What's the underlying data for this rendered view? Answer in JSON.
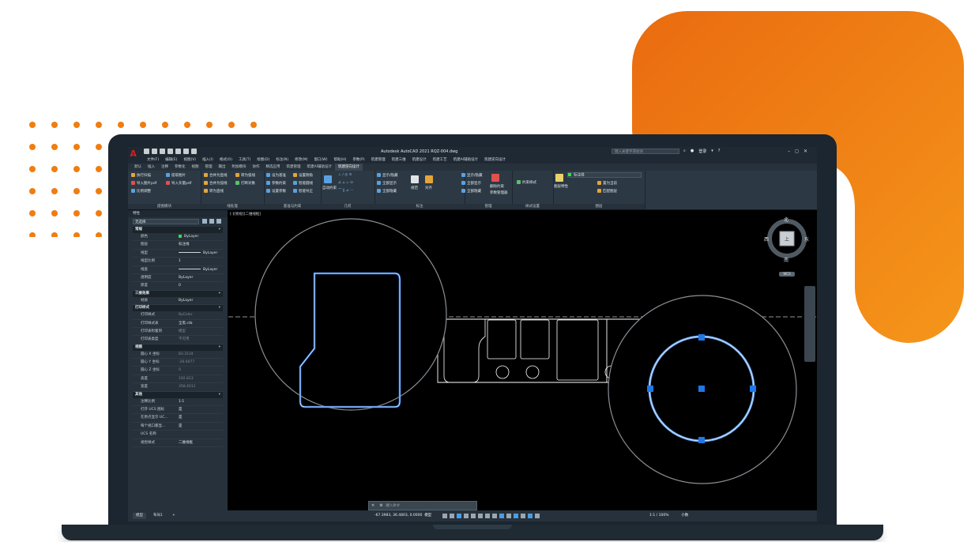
{
  "app": {
    "window_title": "Autodesk AutoCAD 2021   RQZ-004.dwg",
    "search_placeholder": "键入关键字或短语",
    "login_label": "登录",
    "logo_letter": "A"
  },
  "menus": [
    "文件(F)",
    "编辑(E)",
    "视图(V)",
    "插入(I)",
    "格式(O)",
    "工具(T)",
    "绘图(D)",
    "标注(N)",
    "修改(M)",
    "窗口(W)",
    "帮助(H)",
    "参数(P)",
    "筑建管理",
    "筑建三维",
    "筑建设计",
    "筑建工艺",
    "筑建AI辅助设计",
    "筑建逆向设计"
  ],
  "ribbon_tabs": [
    {
      "label": "默认",
      "active": false
    },
    {
      "label": "插入",
      "active": false
    },
    {
      "label": "注释",
      "active": false
    },
    {
      "label": "参数化",
      "active": false
    },
    {
      "label": "视图",
      "active": false
    },
    {
      "label": "管理",
      "active": false
    },
    {
      "label": "输出",
      "active": false
    },
    {
      "label": "附加模块",
      "active": false
    },
    {
      "label": "协作",
      "active": false
    },
    {
      "label": "精选应用",
      "active": false
    },
    {
      "label": "筑建管理",
      "active": false
    },
    {
      "label": "筑建AI辅助设计",
      "active": false
    },
    {
      "label": "筑建逆向设计",
      "active": true
    }
  ],
  "ribbon": {
    "groups": [
      {
        "title": "提图模块",
        "items": [
          "执行扫描",
          "提取图片",
          "导入图片pdf",
          "导入矢量pdf",
          "比例调整"
        ]
      },
      {
        "title": "线处理",
        "items": [
          "合并为直线",
          "转为弧线",
          "合并为弧线",
          "打断对象",
          "转为直线"
        ]
      },
      {
        "title": "基准与约束",
        "items": [
          "设为基准",
          "设置侧角",
          "参数约束",
          "智能圆线",
          "设置参数",
          "智能导正"
        ]
      },
      {
        "title": "几何",
        "items": [
          "自动约束"
        ]
      },
      {
        "title": "标注",
        "items": [
          "显示/隐藏",
          "全部显示",
          "全部隐藏",
          "规范",
          "对齐"
        ]
      },
      {
        "title": "管理",
        "items": [
          "显示/隐藏",
          "全部显示",
          "全部隐藏",
          "删除约束",
          "参数管理器"
        ]
      },
      {
        "title": "样式设置",
        "items": [
          "约束样式"
        ]
      },
      {
        "title": "图层",
        "items": [
          "图层特性",
          "置为当前",
          "匹配图层"
        ],
        "layer_value": "标注线"
      }
    ]
  },
  "palette": {
    "header": "特性",
    "selection": "无选择",
    "sections": [
      {
        "title": "常规",
        "rows": [
          {
            "k": "颜色",
            "v": "ByLayer",
            "swatch": true
          },
          {
            "k": "图层",
            "v": "标注线"
          },
          {
            "k": "线型",
            "v": "ByLayer",
            "line": true
          },
          {
            "k": "线型比例",
            "v": "1"
          },
          {
            "k": "线宽",
            "v": "ByLayer",
            "line": true
          },
          {
            "k": "透明度",
            "v": "ByLayer"
          },
          {
            "k": "厚度",
            "v": "0"
          }
        ]
      },
      {
        "title": "三维效果",
        "rows": [
          {
            "k": "材质",
            "v": "ByLayer"
          }
        ]
      },
      {
        "title": "打印样式",
        "rows": [
          {
            "k": "打印样式",
            "v": "ByColor",
            "dim": true
          },
          {
            "k": "打印样式表",
            "v": "全黑.ctb"
          },
          {
            "k": "打印表附着到",
            "v": "模型",
            "dim": true
          },
          {
            "k": "打印表类型",
            "v": "不可用",
            "dim": true
          }
        ]
      },
      {
        "title": "视图",
        "rows": [
          {
            "k": "圆心 X 坐标",
            "v": "83.3134",
            "dim": true
          },
          {
            "k": "圆心 Y 坐标",
            "v": "-26.6077",
            "dim": true
          },
          {
            "k": "圆心 Z 坐标",
            "v": "0",
            "dim": true
          },
          {
            "k": "高度",
            "v": "192.813",
            "dim": true
          },
          {
            "k": "宽度",
            "v": "358.4011",
            "dim": true
          }
        ]
      },
      {
        "title": "其他",
        "rows": [
          {
            "k": "注释比例",
            "v": "1:1"
          },
          {
            "k": "打开 UCS 图标",
            "v": "是"
          },
          {
            "k": "在原点显示 UC...",
            "v": "是"
          },
          {
            "k": "每个视口都显...",
            "v": "是"
          },
          {
            "k": "UCS 名称",
            "v": ""
          },
          {
            "k": "视觉样式",
            "v": "二维线框"
          }
        ]
      }
    ]
  },
  "canvas": {
    "view_label": "[-][俯视][二维线框]",
    "command_placeholder": "键入命令"
  },
  "viewcube": {
    "north": "北",
    "south": "南",
    "west": "西",
    "east": "东",
    "top": "上",
    "wcs": "WCS"
  },
  "status": {
    "layout_tabs": [
      "模型",
      "布局1"
    ],
    "add_tab": "+",
    "coordinates": "-67.3983, 36.4803, 0.0000",
    "space": "模型",
    "scale": "1:1 / 100%",
    "units": "小数"
  },
  "colors": {
    "accent_orange": "#f07d10",
    "selection_blue": "#1f78e6",
    "background": "#000000",
    "panel": "#26313b"
  }
}
